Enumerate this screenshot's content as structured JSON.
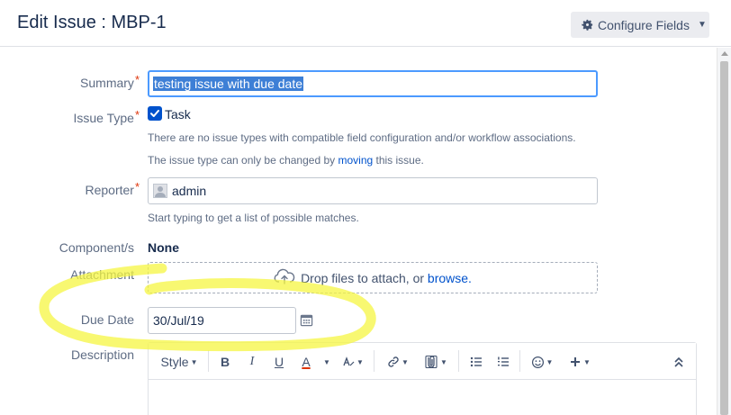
{
  "header": {
    "title": "Edit Issue : MBP-1",
    "configure_label": "Configure Fields"
  },
  "form": {
    "summary": {
      "label": "Summary",
      "required_mark": "*",
      "value": "testing issue with due date"
    },
    "issue_type": {
      "label": "Issue Type",
      "required_mark": "*",
      "value": "Task",
      "checked": true,
      "note1": "There are no issue types with compatible field configuration and/or workflow associations.",
      "note2_prefix": "The issue type can only be changed by ",
      "note2_link": "moving",
      "note2_suffix": " this issue."
    },
    "reporter": {
      "label": "Reporter",
      "required_mark": "*",
      "value": "admin",
      "hint": "Start typing to get a list of possible matches."
    },
    "components": {
      "label": "Component/s",
      "value": "None"
    },
    "attachment": {
      "label": "Attachment",
      "drop_text": "Drop files to attach, or ",
      "browse_link": "browse."
    },
    "due_date": {
      "label": "Due Date",
      "value": "30/Jul/19"
    },
    "description": {
      "label": "Description",
      "toolbar": {
        "style_label": "Style",
        "bold": "B",
        "italic": "I",
        "underline": "U",
        "text_color": "A"
      }
    }
  },
  "annotation": {
    "color": "#f5f542"
  },
  "colors": {
    "accent": "#0052cc",
    "required": "#de350b"
  }
}
